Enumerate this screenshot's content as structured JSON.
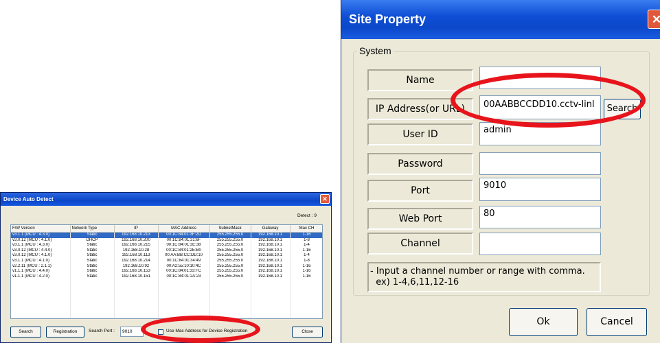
{
  "device_auto_detect": {
    "title": "Device Auto Detect",
    "close_glyph": "✕",
    "detect_label": "Detect :",
    "detect_count": "9",
    "columns": [
      "F/W Version",
      "Network Type",
      "IP",
      "MAC Address",
      "SubnetMask",
      "Gateway",
      "Max CH"
    ],
    "rows": [
      [
        "v3.1.1 (MCU : 4.3.0)",
        "Static",
        "192.168.10.213",
        "00:1C:84:01:3F:2D",
        "255.255.255.0",
        "192.168.10.1",
        "1-16"
      ],
      [
        "v3.0.12 (MCU : 4.1.0)",
        "DHCP",
        "192.168.10.200",
        "00:1C:84:01:31:6F",
        "255.255.255.0",
        "192.168.10.1",
        "1-8"
      ],
      [
        "v3.1.1 (MCU : 4.3.0)",
        "Static",
        "192.168.10.215",
        "00:1C:84:01:3E:38",
        "255.255.255.0",
        "192.168.10.1",
        "1-4"
      ],
      [
        "v3.0.12 (MCU : 4.4.0)",
        "Static",
        "192.168.10.28",
        "00:1C:84:01:2E:B0",
        "255.255.255.0",
        "192.168.10.1",
        "1-16"
      ],
      [
        "v3.0.12 (MCU : 4.1.0)",
        "Static",
        "192.168.10.113",
        "00:AA:BB:CC:DD:10",
        "255.255.255.0",
        "192.168.10.1",
        "1-4"
      ],
      [
        "v3.1.1 (MCU : 4.1.0)",
        "Static",
        "192.168.10.214",
        "00:1C:84:01:34:49",
        "255.255.255.0",
        "192.168.10.1",
        "1-8"
      ],
      [
        "v2.2.11 (MCU : 2.1.1)",
        "Static",
        "192.168.10.92",
        "00:A2:55:10:10:4C",
        "255.255.255.0",
        "192.168.10.1",
        "1-16"
      ],
      [
        "v1.1.1 (MCU : 4.4.0)",
        "Static",
        "192.168.10.153",
        "00:1C:84:01:33:FC",
        "255.255.255.0",
        "192.168.10.1",
        "1-16"
      ],
      [
        "v1.1.1 (MCU : 4.2.0)",
        "Static",
        "192.168.10.151",
        "00:1C:84:01:2A:23",
        "255.255.255.0",
        "192.168.10.1",
        "1-16"
      ]
    ],
    "selected_row": 0,
    "search_button": "Search",
    "registration_button": "Registration",
    "search_port_label": "Search Port :",
    "search_port_value": "9010",
    "mac_checkbox_label": "Use Mac Address for Device Registration",
    "mac_checkbox_checked": false,
    "close_button": "Close"
  },
  "site_property": {
    "title": "Site Property",
    "close_glyph": "✕",
    "group_label": "System",
    "fields": [
      {
        "label": "Name",
        "value": ""
      },
      {
        "label": "IP Address(or URL)",
        "value": "00AABBCCDD10.cctv-linl"
      },
      {
        "label": "User ID",
        "value": "admin"
      },
      {
        "label": "Password",
        "value": ""
      },
      {
        "label": "Port",
        "value": "9010"
      },
      {
        "label": "Web Port",
        "value": "80"
      },
      {
        "label": "Channel",
        "value": ""
      }
    ],
    "search_button": "Search",
    "note_line1": "- Input a channel number or range with comma.",
    "note_line2": "  ex) 1-4,6,11,12-16",
    "ok_button": "Ok",
    "cancel_button": "Cancel"
  },
  "colors": {
    "annotation_ring": "#e8141c",
    "title_bar": "#0b48c9",
    "dialog_bg": "#ece9d8",
    "selection": "#316ac5"
  }
}
